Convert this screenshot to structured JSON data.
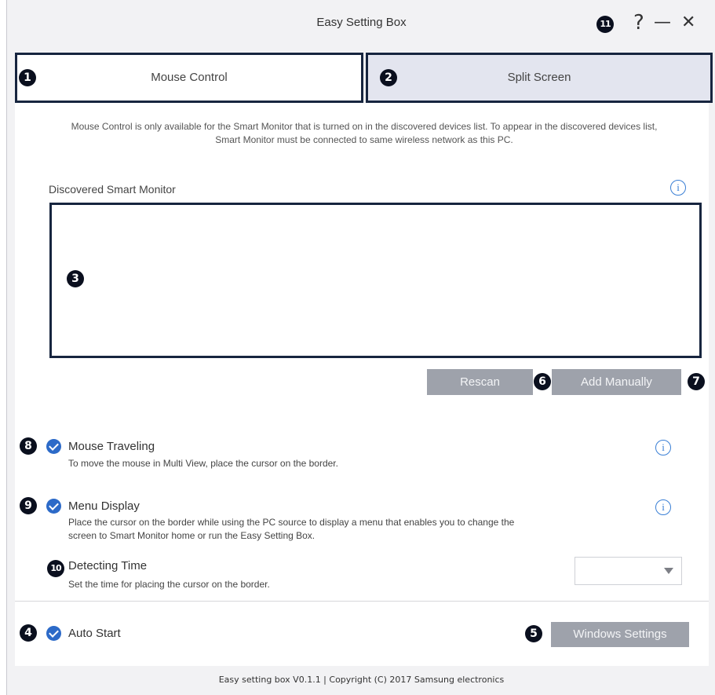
{
  "window": {
    "title": "Easy Setting Box"
  },
  "titlebar": {
    "help": "?",
    "minimize": "—",
    "close": "✕"
  },
  "markers": [
    "1",
    "2",
    "3",
    "4",
    "5",
    "6",
    "7",
    "8",
    "9",
    "10",
    "11"
  ],
  "tabs": [
    {
      "label": "Mouse Control",
      "active": true
    },
    {
      "label": "Split Screen",
      "active": false
    }
  ],
  "mouse_control": {
    "description": "Mouse Control is only available for the Smart Monitor that is turned on in the discovered devices list. To appear in the discovered devices list, Smart Monitor must be connected to same wireless network as this PC.",
    "discovered_label": "Discovered Smart Monitor",
    "discovered_devices": [],
    "buttons": {
      "rescan": "Rescan",
      "add_manually": "Add Manually"
    },
    "options": [
      {
        "title": "Mouse Traveling",
        "checked": true,
        "description": "To move the mouse in Multi View, place the cursor on the border."
      },
      {
        "title": "Menu Display",
        "checked": true,
        "description": "Place the cursor on the border while using the PC source to display a menu that enables you to change the screen to Smart Monitor home or run the Easy Setting Box."
      },
      {
        "title": "Detecting Time",
        "description": "Set the time for placing the cursor on the border.",
        "selected_value": ""
      }
    ],
    "auto_start": {
      "label": "Auto Start",
      "checked": true
    },
    "windows_settings": "Windows Settings"
  },
  "footer": "Easy setting box V0.1.1 | Copyright (C) 2017 Samsung electronics",
  "colors": {
    "accent_blue": "#2c6ac8",
    "button_gray": "#9ea2ab",
    "border_navy": "#17253f",
    "tab_inactive": "#e3e5ef"
  },
  "icons": [
    "info-icon",
    "checkmark-icon",
    "dropdown-caret-icon",
    "help-icon",
    "minimize-icon",
    "close-icon"
  ]
}
